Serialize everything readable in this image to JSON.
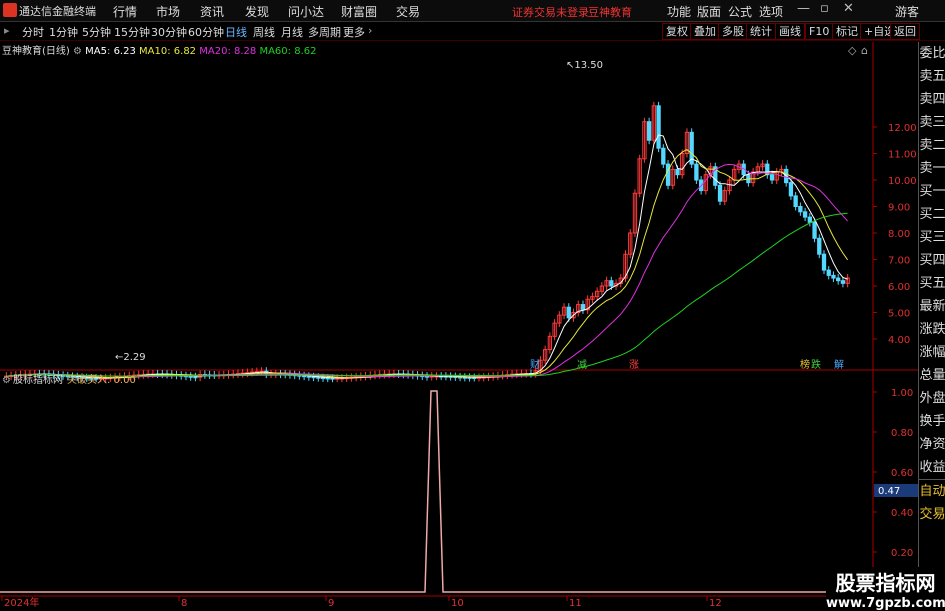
{
  "app": {
    "title": "通达信金融终端",
    "menus": [
      "行情",
      "市场",
      "资讯",
      "发现",
      "问小达",
      "财富圈",
      "交易"
    ],
    "notice": "证券交易未登录",
    "broker": "豆神教育",
    "right_menus": [
      "功能",
      "版面",
      "公式",
      "选项"
    ],
    "guest": "游客"
  },
  "periods": [
    "分时",
    "1分钟",
    "5分钟",
    "15分钟",
    "30分钟",
    "60分钟",
    "日线",
    "周线",
    "月线",
    "多周期",
    "更多"
  ],
  "active_period": "日线",
  "tools": [
    "复权",
    "叠加",
    "多股",
    "统计",
    "画线",
    "F10",
    "标记",
    "+自选",
    "返回"
  ],
  "stock": {
    "name": "豆神教育(日线)"
  },
  "ma": [
    {
      "label": "MA5",
      "value": "6.23",
      "color": "#ffffff"
    },
    {
      "label": "MA10",
      "value": "6.82",
      "color": "#e8e83a"
    },
    {
      "label": "MA20",
      "value": "8.28",
      "color": "#e030e0"
    },
    {
      "label": "MA60",
      "value": "8.62",
      "color": "#20d020"
    }
  ],
  "price_axis": [
    "12.00",
    "11.00",
    "10.00",
    "9.00",
    "8.00",
    "7.00",
    "6.00",
    "5.00",
    "4.00"
  ],
  "annot": {
    "high": "13.50",
    "low": "2.29"
  },
  "events": [
    "财",
    "减",
    "涨",
    "榜",
    "跌",
    "解"
  ],
  "sub": {
    "name": "股标指标网",
    "indicator": "突破买入: 0.00",
    "axis": [
      "1.00",
      "0.80",
      "0.60",
      "0.47",
      "0.40",
      "0.20",
      "0.00"
    ],
    "current": "0.47"
  },
  "dates": [
    "2024年",
    "8",
    "9",
    "10",
    "11",
    "12"
  ],
  "side": [
    "委比",
    "卖五",
    "卖四",
    "卖三",
    "卖二",
    "卖一",
    "买一",
    "买二",
    "买三",
    "买四",
    "买五",
    "最新",
    "涨跌",
    "涨幅",
    "总量",
    "外盘",
    "换手",
    "净资",
    "收益",
    "自动",
    "交易"
  ],
  "watermark": {
    "cn": "股票指标网",
    "url": "www.7gpzb.com"
  },
  "chart_data": {
    "type": "candlestick",
    "ylim": [
      2,
      14
    ],
    "high": 13.5,
    "low": 2.29,
    "signal": {
      "type": "line",
      "title": "突破买入",
      "values": "0 except spike to 1.00 near Oct 2024",
      "ylim": [
        0,
        1
      ]
    }
  }
}
